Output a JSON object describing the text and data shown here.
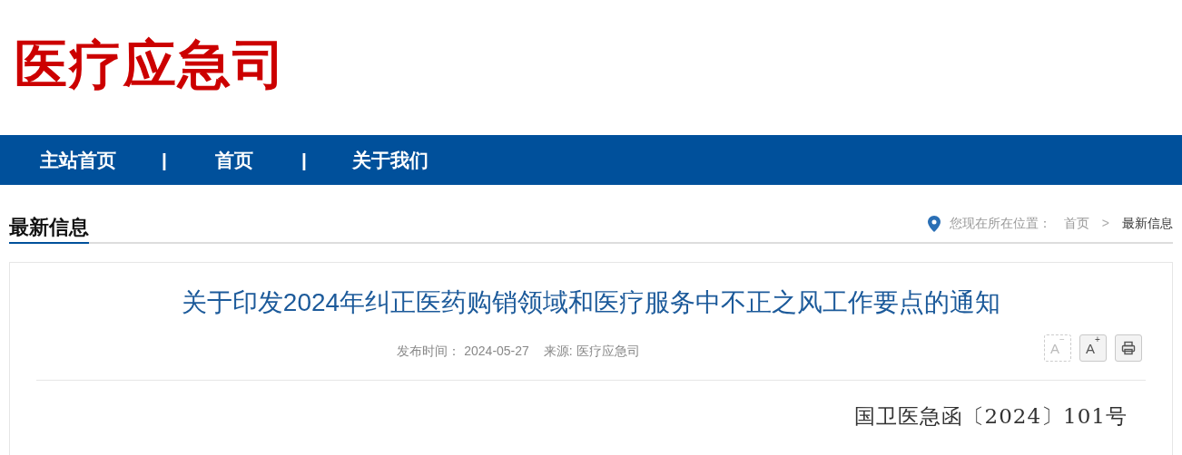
{
  "logo": "医疗应急司",
  "nav": {
    "items": [
      {
        "label": "主站首页"
      },
      {
        "label": "首页"
      },
      {
        "label": "关于我们"
      }
    ],
    "separator": "|"
  },
  "section": {
    "title": "最新信息"
  },
  "breadcrumb": {
    "prefix": "您现在所在位置：",
    "items": [
      "首页",
      "最新信息"
    ],
    "separator": ">"
  },
  "article": {
    "title": "关于印发2024年纠正医药购销领域和医疗服务中不正之风工作要点的通知",
    "meta": [
      {
        "label": "发布时间：",
        "value": "2024-05-27"
      },
      {
        "label": "来源:",
        "value": "医疗应急司"
      }
    ],
    "tools": [
      {
        "kind": "font",
        "label": "A",
        "sign": "−",
        "disabled": true
      },
      {
        "kind": "font",
        "label": "A",
        "sign": "+",
        "disabled": false
      },
      {
        "kind": "print",
        "disabled": false
      }
    ],
    "doc_number": "国卫医急函〔2024〕101号"
  }
}
